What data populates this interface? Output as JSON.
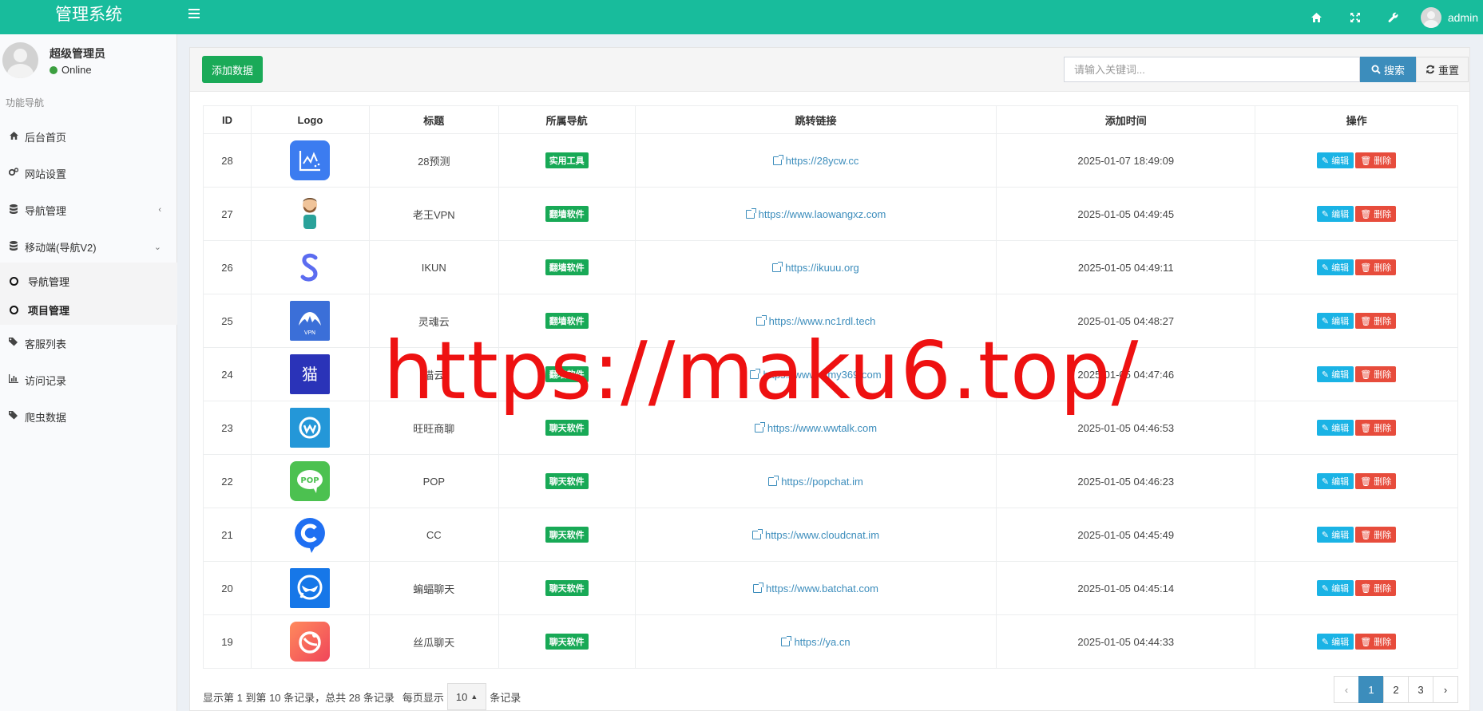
{
  "header": {
    "app_title": "管理系统",
    "user_name": "admin"
  },
  "sidebar": {
    "user_title": "超级管理员",
    "user_status": "Online",
    "menu_header": "功能导航",
    "items": [
      {
        "label": "后台首页",
        "icon": "home-icon"
      },
      {
        "label": "网站设置",
        "icon": "gears-icon"
      },
      {
        "label": "导航管理",
        "icon": "database-icon"
      },
      {
        "label": "移动端(导航V2)",
        "icon": "database-icon"
      }
    ],
    "sub_items": [
      {
        "label": "导航管理"
      },
      {
        "label": "项目管理"
      }
    ],
    "items_bottom": [
      {
        "label": "客服列表",
        "icon": "tags-icon"
      },
      {
        "label": "访问记录",
        "icon": "bar-chart-icon"
      },
      {
        "label": "爬虫数据",
        "icon": "tags-icon"
      }
    ]
  },
  "toolbar": {
    "add_label": "添加数据",
    "search_placeholder": "请输入关键词...",
    "search_label": "搜索",
    "reset_label": "重置"
  },
  "table": {
    "columns": [
      "ID",
      "Logo",
      "标题",
      "所属导航",
      "跳转链接",
      "添加时间",
      "操作"
    ],
    "edit_label": "编辑",
    "delete_label": "删除",
    "rows": [
      {
        "id": "28",
        "title": "28预测",
        "category": "实用工具",
        "url": "https://28ycw.cc",
        "time": "2025-01-07 18:49:09"
      },
      {
        "id": "27",
        "title": "老王VPN",
        "category": "翻墙软件",
        "url": "https://www.laowangxz.com",
        "time": "2025-01-05 04:49:45"
      },
      {
        "id": "26",
        "title": "IKUN",
        "category": "翻墙软件",
        "url": "https://ikuuu.org",
        "time": "2025-01-05 04:49:11"
      },
      {
        "id": "25",
        "title": "灵魂云",
        "category": "翻墙软件",
        "url": "https://www.nc1rdl.tech",
        "time": "2025-01-05 04:48:27"
      },
      {
        "id": "24",
        "title": "猫云",
        "category": "翻墙软件",
        "url": "https://www.mmy369.com",
        "time": "2025-01-05 04:47:46"
      },
      {
        "id": "23",
        "title": "旺旺商聊",
        "category": "聊天软件",
        "url": "https://www.wwtalk.com",
        "time": "2025-01-05 04:46:53"
      },
      {
        "id": "22",
        "title": "POP",
        "category": "聊天软件",
        "url": "https://popchat.im",
        "time": "2025-01-05 04:46:23"
      },
      {
        "id": "21",
        "title": "CC",
        "category": "聊天软件",
        "url": "https://www.cloudcnat.im",
        "time": "2025-01-05 04:45:49"
      },
      {
        "id": "20",
        "title": "蝙蝠聊天",
        "category": "聊天软件",
        "url": "https://www.batchat.com",
        "time": "2025-01-05 04:45:14"
      },
      {
        "id": "19",
        "title": "丝瓜聊天",
        "category": "聊天软件",
        "url": "https://ya.cn",
        "time": "2025-01-05 04:44:33"
      }
    ]
  },
  "footer": {
    "info_prefix": "显示第 1 到第 10 条记录，总共 28 条记录",
    "per_page_label": "每页显示",
    "per_page_value": "10",
    "per_page_suffix": "条记录",
    "pages": [
      "‹",
      "1",
      "2",
      "3",
      "›"
    ],
    "current_page": "1"
  },
  "watermark": "https://maku6.top/",
  "colors": {
    "header": "#18bc9c",
    "add_button": "#1aaa58",
    "search_button": "#3c8dbc",
    "edit": "#1ab3e5",
    "delete": "#e74c3c",
    "watermark": "#ee1111"
  }
}
